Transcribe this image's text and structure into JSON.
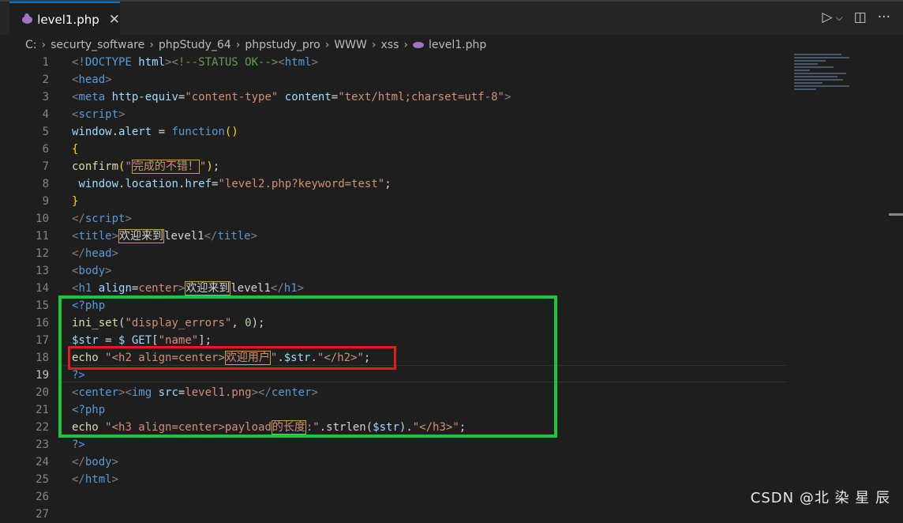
{
  "tab": {
    "icon": "php-elephant-icon",
    "label": "level1.php",
    "close": "✕"
  },
  "actions": {
    "run": "▷",
    "run_menu": "⌵",
    "split": "◫",
    "more": "···"
  },
  "breadcrumb": [
    "C:",
    "securty_software",
    "phpStudy_64",
    "phpstudy_pro",
    "WWW",
    "xss",
    "level1.php"
  ],
  "active_line": 19,
  "watermark": "CSDN @北 染 星 辰",
  "lines": [
    {
      "n": 1,
      "tokens": [
        [
          "t-punc",
          "<!"
        ],
        [
          "t-tag",
          "DOCTYPE "
        ],
        [
          "t-attr",
          "html"
        ],
        [
          "t-punc",
          ">"
        ],
        [
          "t-comm",
          "<!--STATUS OK-->"
        ],
        [
          "t-punc",
          "<"
        ],
        [
          "t-tag",
          "html"
        ],
        [
          "t-punc",
          ">"
        ]
      ]
    },
    {
      "n": 2,
      "tokens": [
        [
          "t-punc",
          "<"
        ],
        [
          "t-tag",
          "head"
        ],
        [
          "t-punc",
          ">"
        ]
      ]
    },
    {
      "n": 3,
      "tokens": [
        [
          "t-punc",
          "<"
        ],
        [
          "t-tag",
          "meta "
        ],
        [
          "t-attr",
          "http-equiv"
        ],
        [
          "t-plain",
          "="
        ],
        [
          "t-str",
          "\"content-type\" "
        ],
        [
          "t-attr",
          "content"
        ],
        [
          "t-plain",
          "="
        ],
        [
          "t-str",
          "\"text/html;charset=utf-8\""
        ],
        [
          "t-punc",
          ">"
        ]
      ]
    },
    {
      "n": 4,
      "tokens": [
        [
          "t-punc",
          "<"
        ],
        [
          "t-tag",
          "script"
        ],
        [
          "t-punc",
          ">"
        ]
      ]
    },
    {
      "n": 5,
      "tokens": [
        [
          "t-var",
          "window"
        ],
        [
          "t-plain",
          "."
        ],
        [
          "t-var",
          "alert"
        ],
        [
          "t-plain",
          " = "
        ],
        [
          "t-key",
          "function"
        ],
        [
          "t-brace",
          "()"
        ]
      ]
    },
    {
      "n": 6,
      "tokens": [
        [
          "t-brace",
          "{"
        ]
      ]
    },
    {
      "n": 7,
      "tokens": [
        [
          "t-func",
          "confirm"
        ],
        [
          "t-brace",
          "("
        ],
        [
          "t-str",
          "\""
        ],
        [
          "t-str cn",
          "完成的不错！"
        ],
        [
          "t-str",
          "\""
        ],
        [
          "t-brace",
          ")"
        ],
        [
          "t-plain",
          ";"
        ]
      ]
    },
    {
      "n": 8,
      "tokens": [
        [
          "t-plain",
          " "
        ],
        [
          "t-var",
          "window"
        ],
        [
          "t-plain",
          "."
        ],
        [
          "t-var",
          "location"
        ],
        [
          "t-plain",
          "."
        ],
        [
          "t-var",
          "href"
        ],
        [
          "t-plain",
          "="
        ],
        [
          "t-str",
          "\"level2.php?keyword=test\""
        ],
        [
          "t-plain",
          ";"
        ]
      ]
    },
    {
      "n": 9,
      "tokens": [
        [
          "t-brace",
          "}"
        ]
      ]
    },
    {
      "n": 10,
      "tokens": [
        [
          "t-punc",
          "</"
        ],
        [
          "t-tag",
          "script"
        ],
        [
          "t-punc",
          ">"
        ]
      ]
    },
    {
      "n": 11,
      "tokens": [
        [
          "t-punc",
          "<"
        ],
        [
          "t-tag",
          "title"
        ],
        [
          "t-punc",
          ">"
        ],
        [
          "t-plain cn",
          "欢迎来到"
        ],
        [
          "t-plain",
          "level1"
        ],
        [
          "t-punc",
          "</"
        ],
        [
          "t-tag",
          "title"
        ],
        [
          "t-punc",
          ">"
        ]
      ]
    },
    {
      "n": 12,
      "tokens": [
        [
          "t-punc",
          "</"
        ],
        [
          "t-tag",
          "head"
        ],
        [
          "t-punc",
          ">"
        ]
      ]
    },
    {
      "n": 13,
      "tokens": [
        [
          "t-punc",
          "<"
        ],
        [
          "t-tag",
          "body"
        ],
        [
          "t-punc",
          ">"
        ]
      ]
    },
    {
      "n": 14,
      "tokens": [
        [
          "t-punc",
          "<"
        ],
        [
          "t-tag",
          "h1 "
        ],
        [
          "t-attr",
          "align"
        ],
        [
          "t-plain",
          "="
        ],
        [
          "t-str",
          "center"
        ],
        [
          "t-punc",
          ">"
        ],
        [
          "t-plain cn",
          "欢迎来到"
        ],
        [
          "t-plain",
          "level1"
        ],
        [
          "t-punc",
          "</"
        ],
        [
          "t-tag",
          "h1"
        ],
        [
          "t-punc",
          ">"
        ]
      ]
    },
    {
      "n": 15,
      "tokens": [
        [
          "t-tag",
          "<?php"
        ]
      ]
    },
    {
      "n": 16,
      "tokens": [
        [
          "t-func",
          "ini_set"
        ],
        [
          "t-plain",
          "("
        ],
        [
          "t-str",
          "\"display_errors\""
        ],
        [
          "t-plain",
          ", "
        ],
        [
          "t-num",
          "0"
        ],
        [
          "t-plain",
          ");"
        ]
      ]
    },
    {
      "n": 17,
      "tokens": [
        [
          "t-var",
          "$str"
        ],
        [
          "t-plain",
          " = "
        ],
        [
          "t-var",
          "$_GET"
        ],
        [
          "t-plain",
          "["
        ],
        [
          "t-str",
          "\"name\""
        ],
        [
          "t-plain",
          "];"
        ]
      ]
    },
    {
      "n": 18,
      "tokens": [
        [
          "t-func",
          "echo"
        ],
        [
          "t-plain",
          " "
        ],
        [
          "t-str",
          "\"<h2 align=center>"
        ],
        [
          "t-str cn",
          "欢迎用户"
        ],
        [
          "t-str",
          "\""
        ],
        [
          "t-plain",
          "."
        ],
        [
          "t-var",
          "$str"
        ],
        [
          "t-plain",
          "."
        ],
        [
          "t-str",
          "\"</h2>\""
        ],
        [
          "t-plain",
          ";"
        ]
      ]
    },
    {
      "n": 19,
      "tokens": [
        [
          "t-tag",
          "?>"
        ]
      ]
    },
    {
      "n": 20,
      "tokens": [
        [
          "t-punc",
          "<"
        ],
        [
          "t-tag",
          "center"
        ],
        [
          "t-punc",
          "><"
        ],
        [
          "t-tag",
          "img "
        ],
        [
          "t-attr",
          "src"
        ],
        [
          "t-plain",
          "="
        ],
        [
          "t-str",
          "level1.png"
        ],
        [
          "t-punc",
          "></"
        ],
        [
          "t-tag",
          "center"
        ],
        [
          "t-punc",
          ">"
        ]
      ]
    },
    {
      "n": 21,
      "tokens": [
        [
          "t-tag",
          "<?php"
        ]
      ]
    },
    {
      "n": 22,
      "tokens": [
        [
          "t-func",
          "echo"
        ],
        [
          "t-plain",
          " "
        ],
        [
          "t-str",
          "\"<h3 align=center>payload"
        ],
        [
          "t-str cn",
          "的长度"
        ],
        [
          "t-str",
          ":\""
        ],
        [
          "t-plain",
          ".strlen("
        ],
        [
          "t-var",
          "$str"
        ],
        [
          "t-plain",
          ")."
        ],
        [
          "t-str",
          "\"</h3>\""
        ],
        [
          "t-plain",
          ";"
        ]
      ]
    },
    {
      "n": 23,
      "tokens": [
        [
          "t-tag",
          "?>"
        ]
      ]
    },
    {
      "n": 24,
      "tokens": [
        [
          "t-punc",
          "</"
        ],
        [
          "t-tag",
          "body"
        ],
        [
          "t-punc",
          ">"
        ]
      ]
    },
    {
      "n": 25,
      "tokens": [
        [
          "t-punc",
          "</"
        ],
        [
          "t-tag",
          "html"
        ],
        [
          "t-punc",
          ">"
        ]
      ]
    },
    {
      "n": 26,
      "tokens": []
    },
    {
      "n": 27,
      "tokens": []
    }
  ]
}
